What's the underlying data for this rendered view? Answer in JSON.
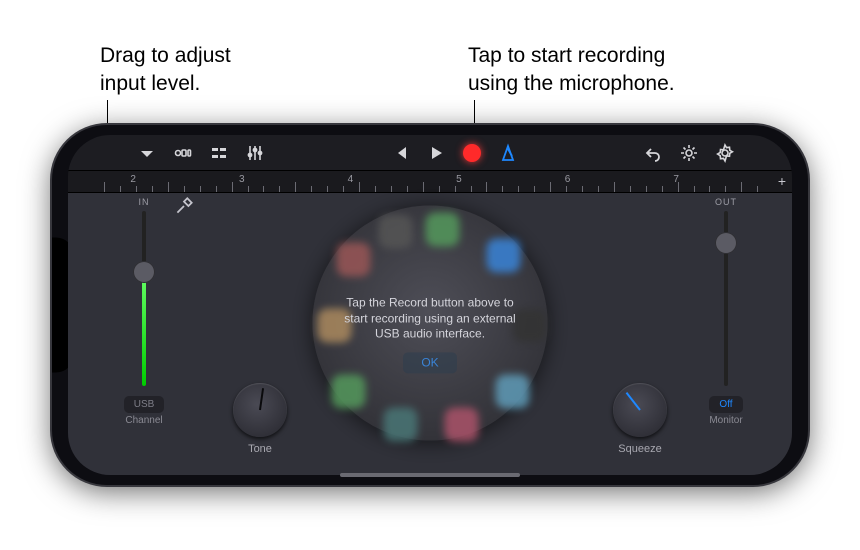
{
  "annotations": {
    "left": "Drag to adjust\ninput level.",
    "right": "Tap to start recording\nusing the microphone."
  },
  "toolbar": {
    "icons": [
      "menu",
      "view-horizontal",
      "view-grid",
      "mixer",
      "prev",
      "play",
      "record",
      "metronome",
      "undo",
      "display",
      "settings"
    ]
  },
  "ruler": {
    "numbers": [
      "2",
      "3",
      "4",
      "5",
      "6",
      "7"
    ],
    "plus": "+"
  },
  "input_slider": {
    "label": "IN",
    "value_pct": 65,
    "bottom_button": "USB",
    "bottom_caption": "Channel"
  },
  "output_slider": {
    "label": "OUT",
    "value_pct": 82,
    "bottom_button": "Off",
    "bottom_caption": "Monitor"
  },
  "knobs": {
    "tone": "Tone",
    "squeeze": "Squeeze"
  },
  "wheel_tooltip": {
    "text": "Tap the Record button above to start recording using an external USB audio interface.",
    "ok": "OK"
  },
  "wheel_colors": [
    "#3fa14a",
    "#1e88ff",
    "#b8881e",
    "#b05050",
    "#b83a3a",
    "#4aa0c8",
    "#6f2f9e",
    "#c84a96",
    "#c8682c",
    "#3a7a7a"
  ]
}
